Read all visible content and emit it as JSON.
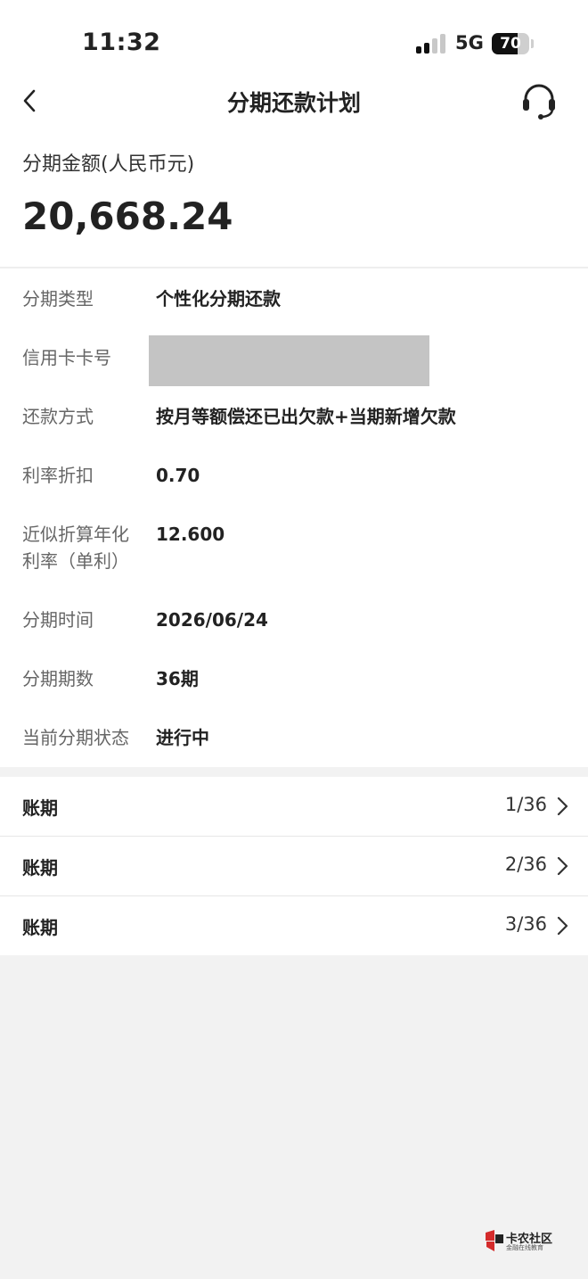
{
  "status": {
    "time": "11:32",
    "network": "5G",
    "battery": "70",
    "battery_level": 0.7
  },
  "nav": {
    "title": "分期还款计划",
    "back_icon": "chevron-left-icon",
    "service_icon": "headset-icon"
  },
  "amount": {
    "label": "分期金额(人民币元)",
    "value": "20,668.24"
  },
  "details": [
    {
      "key": "分期类型",
      "value": "个性化分期还款"
    },
    {
      "key": "信用卡卡号",
      "value": ""
    },
    {
      "key": "还款方式",
      "value": "按月等额偿还已出欠款+当期新增欠款"
    },
    {
      "key": "利率折扣",
      "value": "0.70"
    },
    {
      "key_line1": "近似折算年化",
      "key_line2": "利率（单利）",
      "value": "12.600"
    },
    {
      "key": "分期时间",
      "value": "2026/06/24"
    },
    {
      "key": "分期期数",
      "value": "36期"
    },
    {
      "key": "当前分期状态",
      "value": "进行中"
    }
  ],
  "periods": [
    {
      "label": "账期",
      "value": "1/36"
    },
    {
      "label": "账期",
      "value": "2/36"
    },
    {
      "label": "账期",
      "value": "3/36"
    }
  ],
  "watermark": {
    "name": "卡农社区",
    "tagline": "金融在线教育",
    "color": "#d42b2b"
  }
}
